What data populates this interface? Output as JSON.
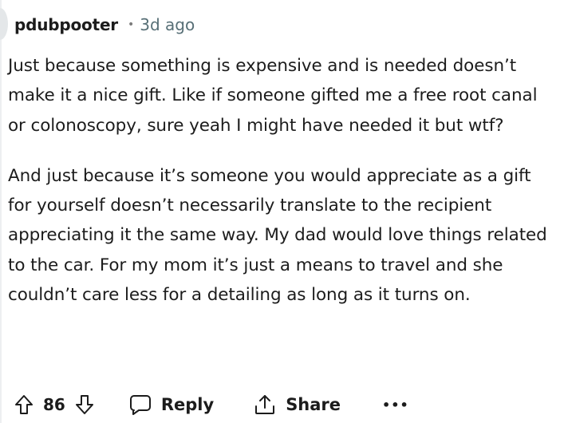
{
  "comment": {
    "username": "pdubpooter",
    "separator": "•",
    "time_ago": "3d ago",
    "paragraphs": [
      "Just because something is expensive and is needed doesn’t make it a nice gift. Like if someone gifted me a free root canal or colonoscopy, sure yeah I might have needed it but wtf?",
      "And just because it’s someone you would appreciate as a gift for yourself doesn’t necessarily translate to the recipient appreciating it the same way. My dad would love things related to the car. For my mom it’s just a means to travel and she couldn’t care less for a detailing as long as it turns on."
    ]
  },
  "actions": {
    "vote_count": "86",
    "reply_label": "Reply",
    "share_label": "Share",
    "more_label": "•••",
    "icons": {
      "upvote": "arrow-up-icon",
      "downvote": "arrow-down-icon",
      "reply": "speech-bubble-icon",
      "share": "share-arrow-icon",
      "more": "ellipsis-icon"
    }
  }
}
